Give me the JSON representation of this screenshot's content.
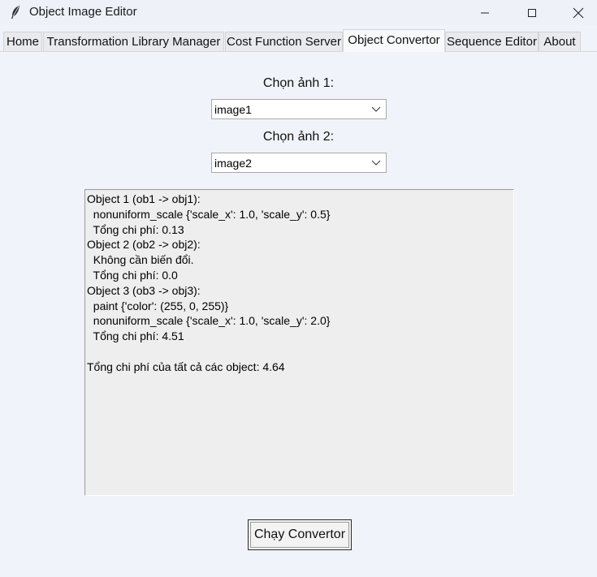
{
  "window": {
    "title": "Object Image Editor"
  },
  "tabs": [
    {
      "label": "Home"
    },
    {
      "label": "Transformation Library Manager"
    },
    {
      "label": "Cost Function Server"
    },
    {
      "label": "Object Convertor"
    },
    {
      "label": "Sequence Editor"
    },
    {
      "label": "About"
    }
  ],
  "active_tab": "Object Convertor",
  "form": {
    "image1_label": "Chọn ảnh 1:",
    "image1_value": "image1",
    "image2_label": "Chọn ảnh 2:",
    "image2_value": "image2"
  },
  "output": {
    "lines": [
      "Object 1 (ob1 -> obj1):",
      "  nonuniform_scale {'scale_x': 1.0, 'scale_y': 0.5}",
      "  Tổng chi phí: 0.13",
      "Object 2 (ob2 -> obj2):",
      "  Không cần biến đổi.",
      "  Tổng chi phí: 0.0",
      "Object 3 (ob3 -> obj3):",
      "  paint {'color': (255, 0, 255)}",
      "  nonuniform_scale {'scale_x': 1.0, 'scale_y': 2.0}",
      "  Tổng chi phí: 4.51",
      "",
      "Tổng chi phí của tất cả các object: 4.64"
    ]
  },
  "run_button": {
    "label": "Chạy Convertor"
  },
  "icons": {
    "app": "feather-icon",
    "minimize": "minimize-icon",
    "maximize": "maximize-icon",
    "close": "close-icon",
    "dropdown": "chevron-down-icon"
  }
}
